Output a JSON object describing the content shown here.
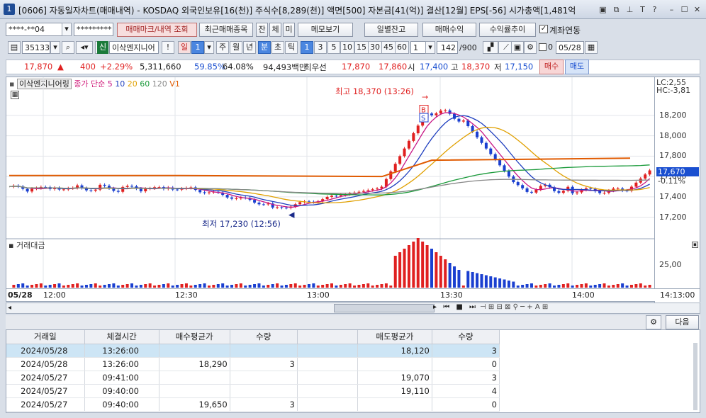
{
  "window": {
    "badge": "1",
    "title": "[0606] 자동일자차트(매매내역) - KOSDAQ 외국인보유[16(천)] 주식수[8,289(천)] 액면[500] 자본금[41(억)] 결산[12월] EPS[-56] 시가총액[1,481억"
  },
  "toolbar1": {
    "account": "****-**04",
    "password": "*********",
    "btn_trade_mark": "매매마크/내역 조회",
    "btn_recent": "최근매매종목",
    "btn_jan": "잔",
    "btn_che": "체",
    "btn_mi": "미",
    "btn_memo": "메모보기",
    "btn_daily": "일별잔고",
    "btn_profit": "매매수익",
    "btn_rate": "수익률추이",
    "chk_account_link": "계좌연동"
  },
  "toolbar2": {
    "code": "351330",
    "badge_sin": "신",
    "stock_name": "이삭엔지니어",
    "excl": "!",
    "period_day": "일",
    "period_sel": "1",
    "periods": [
      "주",
      "월",
      "년"
    ],
    "units": [
      "분",
      "초",
      "틱"
    ],
    "mins": [
      "1",
      "3",
      "5",
      "10",
      "15",
      "30",
      "45",
      "60"
    ],
    "count_sel": "1",
    "range": "142",
    "range_total": "/900",
    "date": "05/28",
    "d0": "0"
  },
  "info": {
    "price": "17,870",
    "arrow": "▲",
    "change": "400",
    "pct": "+2.29%",
    "volume": "5,311,660",
    "vol_ratio": "59.85%",
    "turnover": "64.08%",
    "amount": "94,493백만",
    "best_label": "최우선",
    "best_ask": "17,870",
    "best_bid": "17,860",
    "open_label": "시",
    "open": "17,400",
    "high_label": "고",
    "high": "18,370",
    "low_label": "저",
    "low": "17,150",
    "buy_btn": "매수",
    "sell_btn": "매도"
  },
  "chart_legend": {
    "name": "이삭엔지니어링",
    "ma_label": "종가 단순",
    "ma5": "5",
    "ma10": "10",
    "ma20": "20",
    "ma60": "60",
    "ma120": "120",
    "v1": "V1"
  },
  "annotations": {
    "high_note": "최고 18,370 (13:26)",
    "low_note": "최저 17,230 (12:56)",
    "lc": "LC:2,55",
    "hc": "HC:-3,81",
    "last_price": "17,670",
    "last_pct": "-0.11%",
    "volume_title": "거래대금",
    "vol_tick": "25,00"
  },
  "chart_data": {
    "type": "candlestick",
    "ylim": [
      17100,
      18450
    ],
    "y_ticks": [
      "18,200",
      "18,000",
      "17,800",
      "17,600",
      "17,400",
      "17,200"
    ],
    "y_values": [
      18200,
      18000,
      17800,
      17600,
      17400,
      17200
    ],
    "x_ticks": [
      "05/28",
      "12:00",
      "12:30",
      "13:00",
      "13:30",
      "14:00",
      "14:13:00"
    ],
    "high": 18370,
    "low": 17230,
    "last": 17670,
    "ref_lines": [
      {
        "name": "orange-level",
        "values": [
          17610,
          17610,
          17600,
          17600,
          17590,
          17600,
          17610,
          17760,
          17780,
          17780,
          17780
        ]
      },
      {
        "name": "ma-orange-slow",
        "values": [
          17500,
          17500,
          17480,
          17480,
          17440,
          17470,
          17500,
          17860,
          17980,
          17560,
          17440,
          17460,
          17490
        ]
      }
    ]
  },
  "grid": {
    "headers": [
      "거래일",
      "체결시간",
      "매수평균가",
      "수량",
      "",
      "매도평균가",
      "수량"
    ],
    "rows": [
      [
        "2024/05/28",
        "13:26:00",
        "",
        "",
        "",
        "18,120",
        "3"
      ],
      [
        "2024/05/28",
        "13:26:00",
        "18,290",
        "3",
        "",
        "",
        "0"
      ],
      [
        "2024/05/27",
        "09:41:00",
        "",
        "",
        "",
        "19,070",
        "3"
      ],
      [
        "2024/05/27",
        "09:40:00",
        "",
        "",
        "",
        "19,110",
        "4"
      ],
      [
        "2024/05/27",
        "09:40:00",
        "19,650",
        "3",
        "",
        "",
        "0"
      ]
    ],
    "next_btn": "다음"
  }
}
